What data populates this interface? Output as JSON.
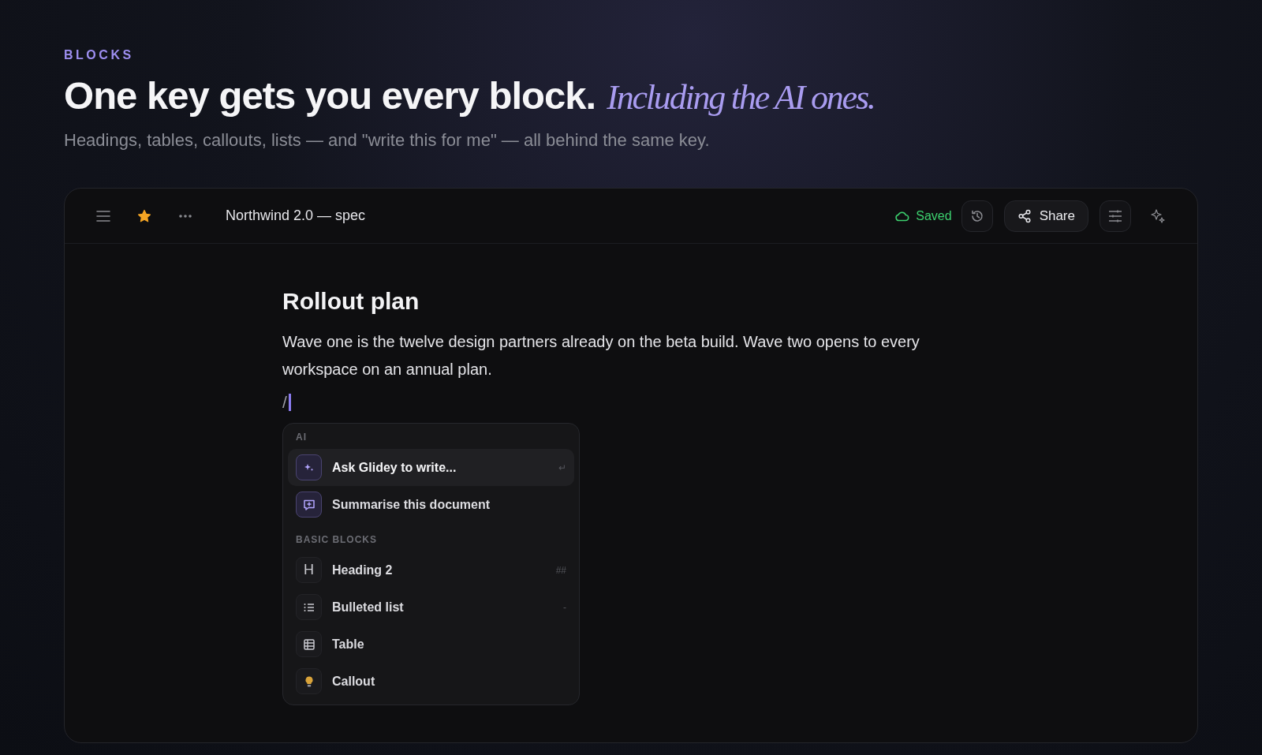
{
  "hero": {
    "eyebrow": "BLOCKS",
    "headline": "One key gets you every block.",
    "headline_accent": "Including the AI ones.",
    "subtitle": "Headings, tables, callouts, lists — and \"write this for me\" — all behind the same key."
  },
  "toolbar": {
    "starred": true,
    "document_title": "Northwind 2.0 — spec",
    "save_status": "Saved",
    "share_label": "Share"
  },
  "document": {
    "heading": "Rollout plan",
    "paragraph": "Wave one is the twelve design partners already on the beta build. Wave two opens to every workspace on an annual plan.",
    "typed": "/"
  },
  "slash_menu": {
    "groups": [
      {
        "label": "AI",
        "items": [
          {
            "kind": "sparkle",
            "label": "Ask Glidey to write...",
            "shortcut": "↵",
            "selected": true
          },
          {
            "kind": "summary",
            "label": "Summarise this document",
            "selected": false
          }
        ]
      },
      {
        "label": "BASIC BLOCKS",
        "items": [
          {
            "kind": "heading",
            "glyph": "H",
            "label": "Heading 2",
            "shortcut": "##",
            "selected": false
          },
          {
            "kind": "list",
            "label": "Bulleted list",
            "shortcut": "-",
            "selected": false
          },
          {
            "kind": "table",
            "label": "Table",
            "selected": false
          },
          {
            "kind": "callout",
            "label": "Callout",
            "selected": false
          }
        ]
      }
    ]
  }
}
